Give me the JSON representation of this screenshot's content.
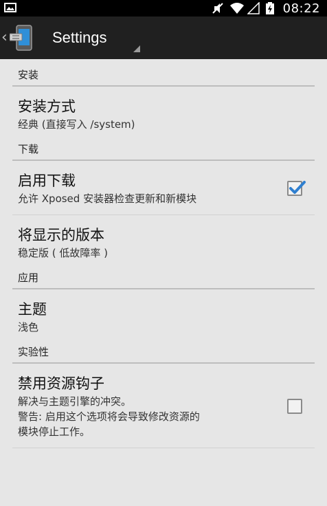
{
  "status_bar": {
    "time": "08:22",
    "icons": [
      "image-icon",
      "mute-icon",
      "wifi-icon",
      "signal-icon",
      "battery-icon"
    ]
  },
  "action_bar": {
    "title": "Settings"
  },
  "sections": [
    {
      "title": "安装",
      "items": [
        {
          "title": "安装方式",
          "summary": "经典 (直接写入 /system)"
        }
      ]
    },
    {
      "title": "下载",
      "items": [
        {
          "title": "启用下载",
          "summary": "允许 Xposed 安装器检查更新和新模块",
          "checked": true
        },
        {
          "title": "将显示的版本",
          "summary": "稳定版 ( 低故障率 )"
        }
      ]
    },
    {
      "title": "应用",
      "items": [
        {
          "title": "主题",
          "summary": "浅色"
        }
      ]
    },
    {
      "title": "实验性",
      "items": [
        {
          "title": "禁用资源钩子",
          "summary": "解决与主题引擎的冲突。\n警告: 启用这个选项将会导致修改资源的\n模块停止工作。",
          "checked": false
        }
      ]
    }
  ],
  "colors": {
    "accent_blue": "#2f7fd0",
    "action_bar": "#202020",
    "background": "#e6e6e6"
  }
}
